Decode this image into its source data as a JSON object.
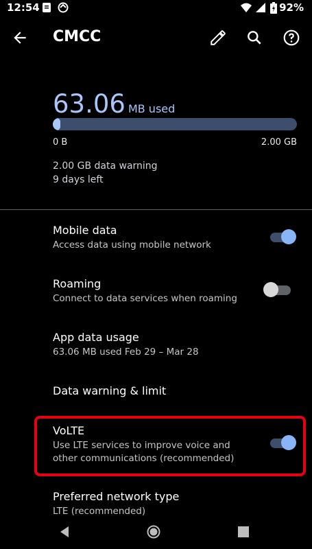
{
  "status_bar": {
    "time": "12:54",
    "battery": "92%",
    "icons": [
      "sim-card-icon",
      "sync-icon",
      "wifi-icon",
      "signal-icon",
      "battery-icon"
    ]
  },
  "app_bar": {
    "title": "CMCC",
    "actions": [
      "back-arrow-icon",
      "edit-pencil-icon",
      "search-icon",
      "help-icon"
    ]
  },
  "usage": {
    "amount": "63.06",
    "unit": "MB used",
    "fill_fraction": 0.03,
    "min_label": "0 B",
    "max_label": "2.00 GB",
    "warning": "2.00 GB data warning",
    "days_left": "9 days left"
  },
  "settings": [
    {
      "title": "Mobile data",
      "subtitle": "Access data using mobile network",
      "toggle": true
    },
    {
      "title": "Roaming",
      "subtitle": "Connect to data services when roaming",
      "toggle": false
    },
    {
      "title": "App data usage",
      "subtitle": "63.06 MB used Feb 29 – Mar 28"
    },
    {
      "title": "Data warning & limit"
    },
    {
      "title": "VoLTE",
      "subtitle": "Use LTE services to improve voice and other communications (recommended)",
      "toggle": true
    },
    {
      "title": "Preferred network type",
      "subtitle": "LTE (recommended)"
    }
  ],
  "colors": {
    "accent": "#8ab4f8",
    "highlight_border": "#e60012"
  },
  "nav": [
    "back-triangle-icon",
    "home-circle-icon",
    "recents-square-icon"
  ]
}
